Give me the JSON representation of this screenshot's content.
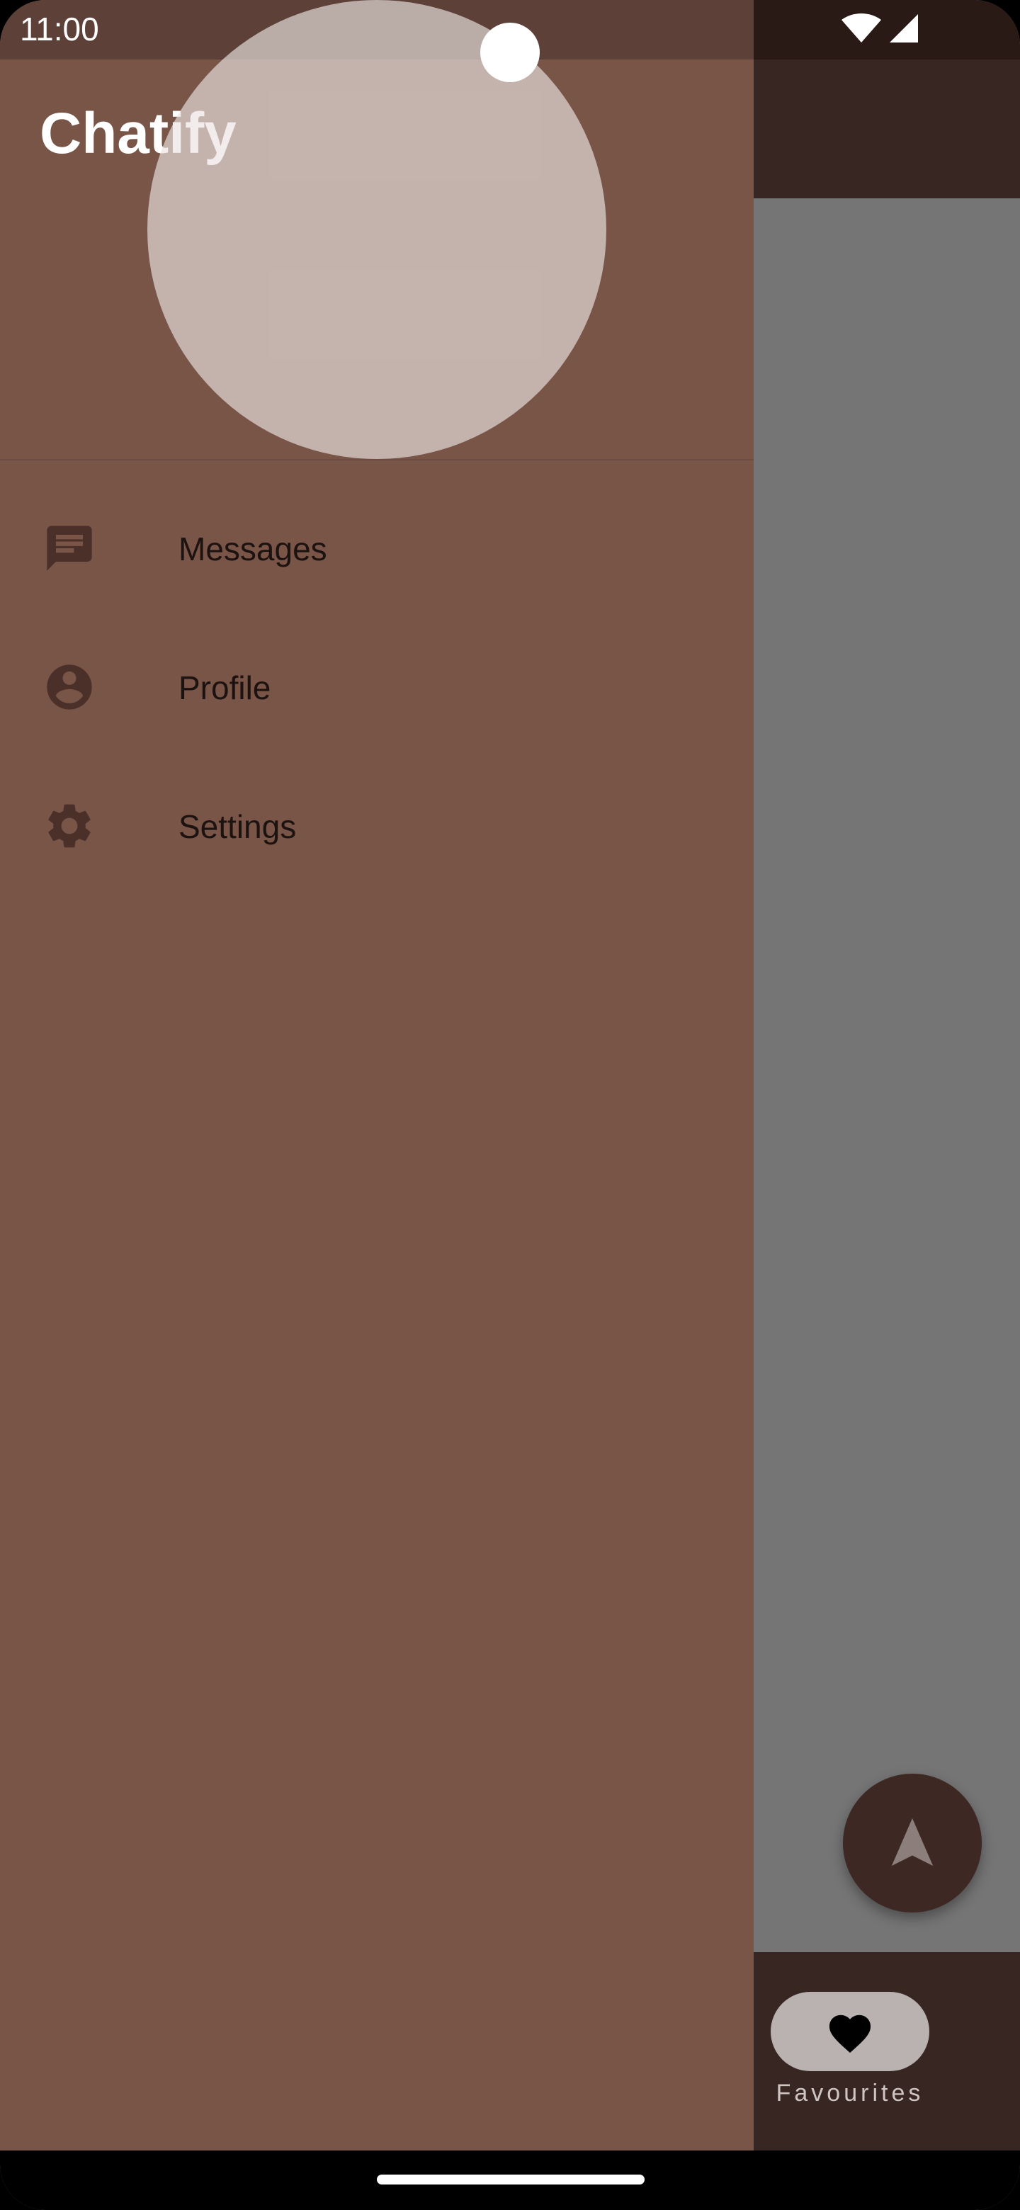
{
  "status_bar": {
    "time": "11:00",
    "icons": [
      "wifi-icon",
      "cellular-signal-icon"
    ]
  },
  "drawer": {
    "app_title": "Chatify",
    "menu": [
      {
        "label": "Messages",
        "icon": "message-icon"
      },
      {
        "label": "Profile",
        "icon": "account-circle-icon"
      },
      {
        "label": "Settings",
        "icon": "gear-icon"
      }
    ]
  },
  "background_app": {
    "fab_icon": "navigation-arrow-icon",
    "bottom_nav": {
      "items": [
        {
          "label": "Favourites",
          "icon": "heart-icon",
          "selected": true
        }
      ]
    }
  },
  "colors": {
    "drawer": "#795548",
    "drawer_status_bar": "#5d4037",
    "app_bar": "#372622",
    "scrim": "#757575",
    "menu_text": "#1c1210",
    "menu_icon": "#4b302a"
  }
}
